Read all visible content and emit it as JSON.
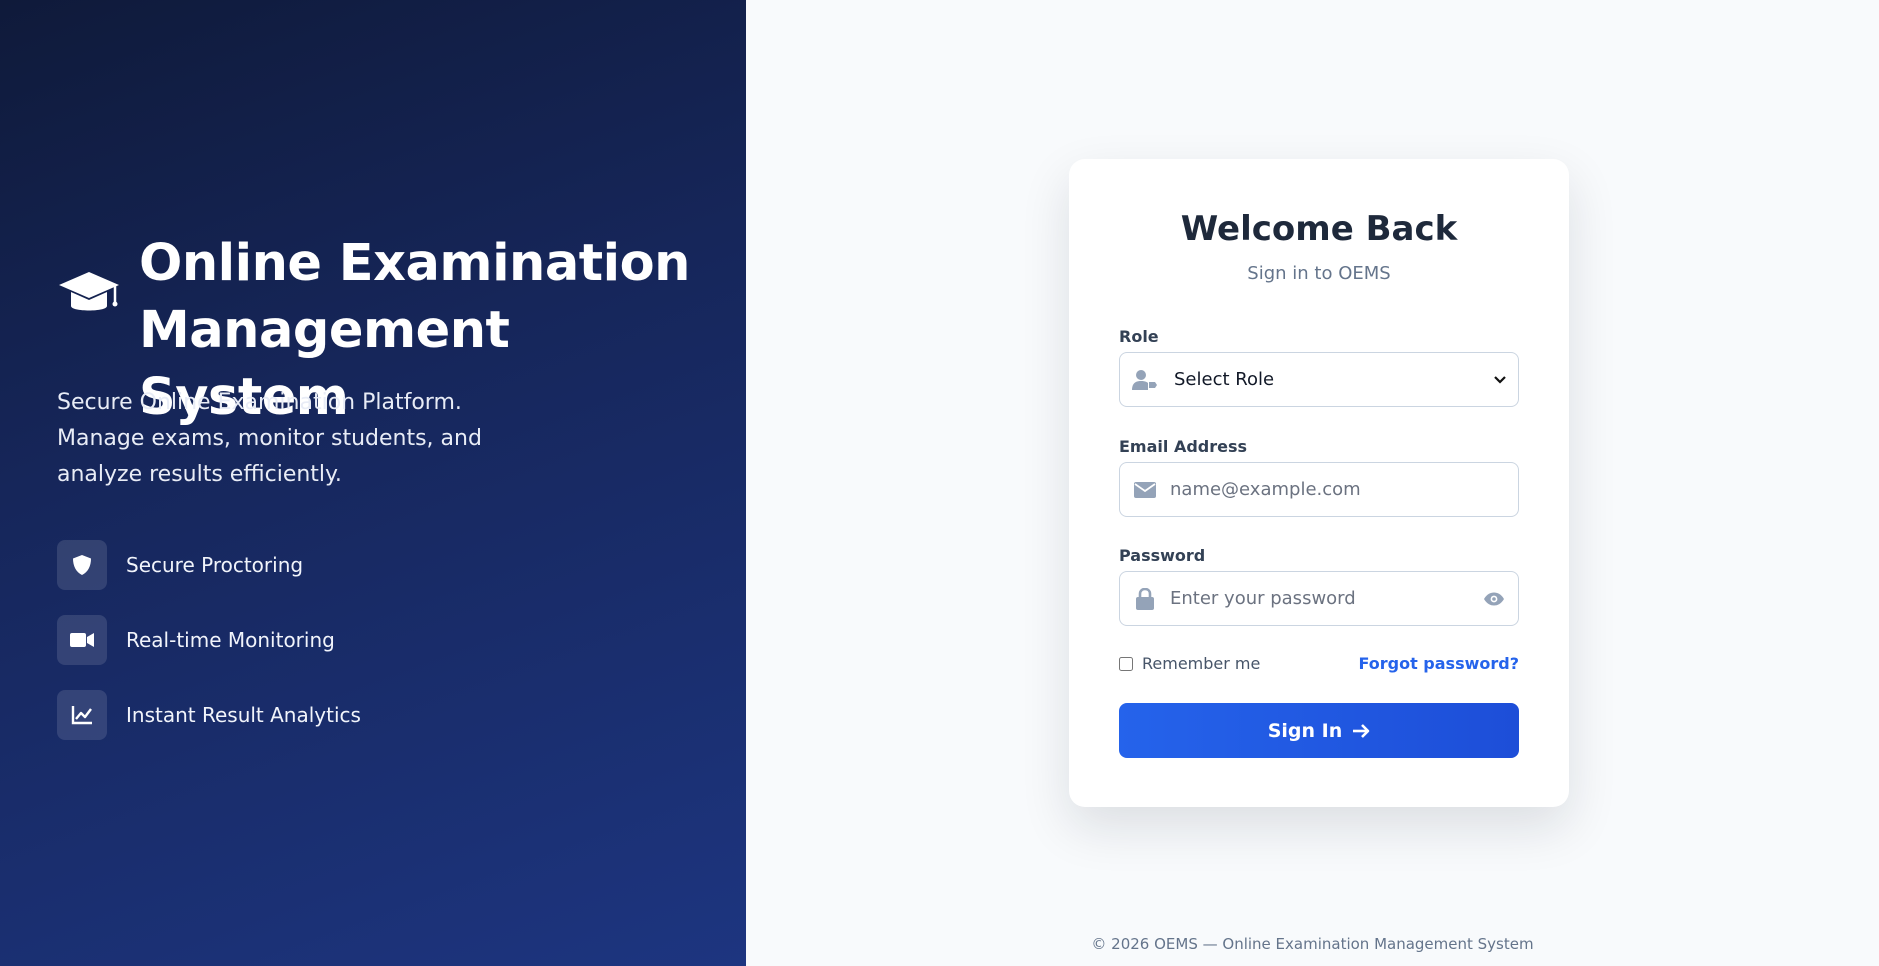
{
  "brand": {
    "icon": "graduation-cap-icon",
    "title": "Online Examination Management System"
  },
  "tagline": {
    "line1": "Secure Online Examination Platform.",
    "line2": "Manage exams, monitor students, and analyze results efficiently."
  },
  "features": [
    {
      "icon": "shield-icon",
      "label": "Secure Proctoring"
    },
    {
      "icon": "video-camera-icon",
      "label": "Real-time Monitoring"
    },
    {
      "icon": "line-chart-icon",
      "label": "Instant Result Analytics"
    }
  ],
  "card": {
    "title": "Welcome Back",
    "subtitle": "Sign in to OEMS",
    "role": {
      "label": "Role",
      "selected": "Select Role",
      "icon": "user-tag-icon"
    },
    "email": {
      "label": "Email Address",
      "placeholder": "name@example.com",
      "value": "",
      "icon": "envelope-icon"
    },
    "password": {
      "label": "Password",
      "placeholder": "Enter your password",
      "value": "",
      "icon": "lock-icon",
      "toggle_icon": "eye-icon"
    },
    "remember_label": "Remember me",
    "forgot_label": "Forgot password?",
    "signin_label": "Sign In",
    "signin_icon": "arrow-right-icon"
  },
  "footer": "© 2026 OEMS — Online Examination Management System",
  "colors": {
    "panel_dark": "#0f1a3a",
    "panel_light": "#1d3580",
    "primary": "#2563eb",
    "text_dark": "#1e293b",
    "background": "#f8fafc"
  }
}
